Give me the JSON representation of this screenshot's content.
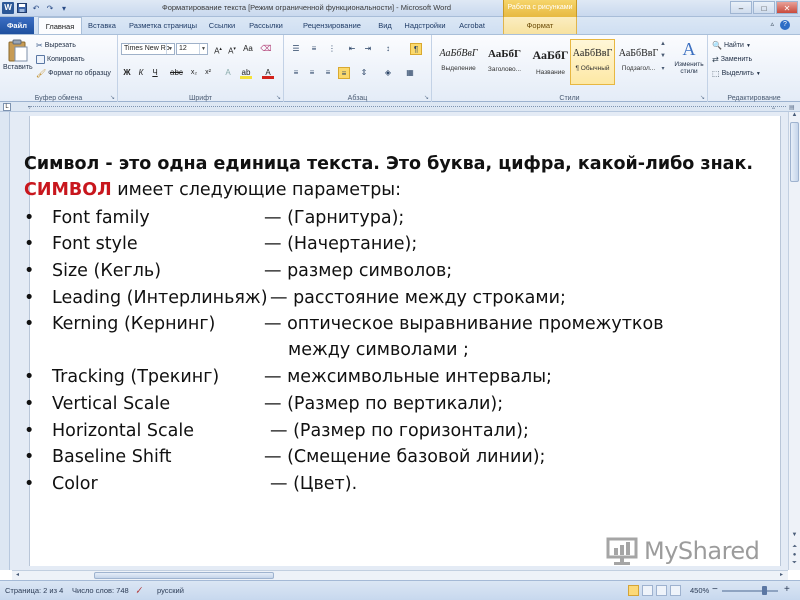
{
  "window": {
    "title": "Форматирование текста [Режим ограниченной функциональности]  -  Microsoft Word",
    "context_header": "Работа с рисунками",
    "app_icon": "W"
  },
  "tabs": [
    {
      "label": "Файл"
    },
    {
      "label": "Главная"
    },
    {
      "label": "Вставка"
    },
    {
      "label": "Разметка страницы"
    },
    {
      "label": "Ссылки"
    },
    {
      "label": "Рассылки"
    },
    {
      "label": "Рецензирование"
    },
    {
      "label": "Вид"
    },
    {
      "label": "Надстройки"
    },
    {
      "label": "Acrobat"
    },
    {
      "label": "Формат"
    }
  ],
  "ribbon": {
    "clipboard": {
      "paste": "Вставить",
      "cut": "Вырезать",
      "copy": "Копировать",
      "format_painter": "Формат по образцу",
      "group": "Буфер обмена"
    },
    "font": {
      "font_name": "Times New Ro",
      "font_size": "12",
      "group": "Шрифт",
      "bold": "Ж",
      "italic": "К",
      "underline": "Ч"
    },
    "paragraph": {
      "group": "Абзац",
      "pilcrow": "¶"
    },
    "styles": {
      "group": "Стили",
      "items": [
        {
          "sample": "АаБбВвГ",
          "name": "Выделение"
        },
        {
          "sample": "АаБбГ",
          "name": "Заголово..."
        },
        {
          "sample": "АаБбГ",
          "name": "Название"
        },
        {
          "sample": "АаБбВвГ",
          "name": "¶ Обычный"
        },
        {
          "sample": "АаБбВвГ",
          "name": "Подзагол..."
        }
      ],
      "change_styles": "Изменить стили"
    },
    "editing": {
      "group": "Редактирование",
      "find": "Найти",
      "replace": "Заменить",
      "select": "Выделить"
    }
  },
  "document": {
    "line1": "Символ - это одна единица текста. Это буква, цифра, какой-либо знак.",
    "line2_highlight": "СИМВОЛ",
    "line2_rest": " имеет следующие параметры:",
    "items": [
      {
        "term": "Font family",
        "desc": "— (Гарнитура);"
      },
      {
        "term": "Font style",
        "desc": "— (Начертание);"
      },
      {
        "term": "Size (Кегль)",
        "desc": "— размер символов;"
      },
      {
        "term": "Leading (Интерлиньяж)",
        "desc": "— расстояние между строками;"
      },
      {
        "term": "Kerning (Кернинг)",
        "desc": "— оптическое выравнивание промежутков"
      },
      {
        "term": "",
        "desc": "между символами ;"
      },
      {
        "term": "Tracking (Трекинг)",
        "desc": "— межсимвольные интервалы;"
      },
      {
        "term": "Vertical Scale",
        "desc": "— (Размер по вертикали);"
      },
      {
        "term": "Horizontal Scale",
        "desc": "— (Размер по горизонтали);"
      },
      {
        "term": "Baseline Shift",
        "desc": "— (Смещение базовой линии);"
      },
      {
        "term": "Color",
        "desc": "— (Цвет)."
      }
    ],
    "bullet": "•"
  },
  "status": {
    "page": "Страница: 2 из 4",
    "words": "Число слов: 748",
    "language": "русский",
    "zoom": "450%"
  },
  "watermark": "MyShared"
}
